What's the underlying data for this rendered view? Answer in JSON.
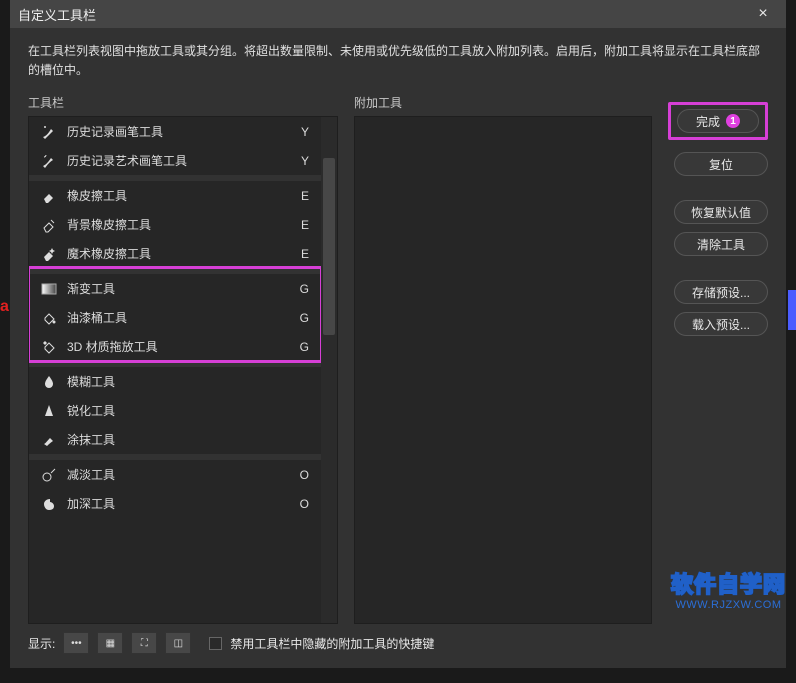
{
  "dialog": {
    "title": "自定义工具栏",
    "description": "在工具栏列表视图中拖放工具或其分组。将超出数量限制、未使用或优先级低的工具放入附加列表。启用后，附加工具将显示在工具栏底部的槽位中。"
  },
  "left": {
    "label": "工具栏"
  },
  "mid": {
    "label": "附加工具"
  },
  "groups": [
    {
      "tools": [
        {
          "name": "历史记录画笔工具",
          "key": "Y",
          "icon": "history-brush"
        },
        {
          "name": "历史记录艺术画笔工具",
          "key": "Y",
          "icon": "art-history-brush"
        }
      ]
    },
    {
      "tools": [
        {
          "name": "橡皮擦工具",
          "key": "E",
          "icon": "eraser"
        },
        {
          "name": "背景橡皮擦工具",
          "key": "E",
          "icon": "bg-eraser"
        },
        {
          "name": "魔术橡皮擦工具",
          "key": "E",
          "icon": "magic-eraser"
        }
      ]
    },
    {
      "highlighted": true,
      "tools": [
        {
          "name": "渐变工具",
          "key": "G",
          "icon": "gradient"
        },
        {
          "name": "油漆桶工具",
          "key": "G",
          "icon": "paint-bucket"
        },
        {
          "name": "3D 材质拖放工具",
          "key": "G",
          "icon": "3d-material"
        }
      ]
    },
    {
      "tools": [
        {
          "name": "模糊工具",
          "key": "",
          "icon": "blur"
        },
        {
          "name": "锐化工具",
          "key": "",
          "icon": "sharpen"
        },
        {
          "name": "涂抹工具",
          "key": "",
          "icon": "smudge"
        }
      ]
    },
    {
      "tools": [
        {
          "name": "减淡工具",
          "key": "O",
          "icon": "dodge"
        },
        {
          "name": "加深工具",
          "key": "O",
          "icon": "burn"
        }
      ]
    }
  ],
  "buttons": {
    "done": "完成",
    "done_badge": "1",
    "reset": "复位",
    "restore_defaults": "恢复默认值",
    "clear_tools": "清除工具",
    "save_preset": "存储预设...",
    "load_preset": "载入预设..."
  },
  "footer": {
    "show_label": "显示:",
    "swatches": [
      "•••",
      "▦",
      "⛶",
      "◫"
    ],
    "checkbox_label": "禁用工具栏中隐藏的附加工具的快捷键"
  },
  "watermark": {
    "main": "软件自学网",
    "sub": "WWW.RJZXW.COM"
  }
}
